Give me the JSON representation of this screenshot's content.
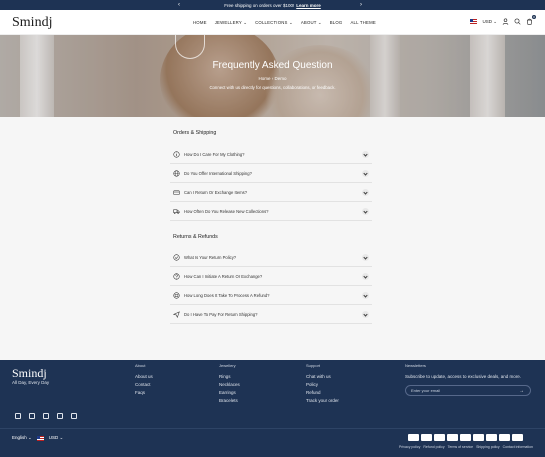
{
  "announcement": {
    "text": "Free shipping on orders over $100!",
    "link": "Learn more",
    "prev": "‹",
    "next": "›"
  },
  "header": {
    "logo": "Smindj",
    "nav": [
      "HOME",
      "JEWELLERY ⌄",
      "COLLECTIONS ⌄",
      "ABOUT ⌄",
      "BLOG",
      "ALL THEME"
    ],
    "currency": "USD ⌄",
    "cart_count": "0"
  },
  "hero": {
    "title": "Frequently Asked Question",
    "breadcrumb_home": "Home",
    "breadcrumb_sep": "›",
    "breadcrumb_current": "Demo",
    "subtitle": "Connect with us directly for questions, collaborations, or feedback."
  },
  "faq": {
    "section1": "Orders & Shipping",
    "section1_items": [
      {
        "q": "How Do I Care For My Clothing?",
        "icon": "info-icon"
      },
      {
        "q": "Do You Offer International Shipping?",
        "icon": "globe-icon"
      },
      {
        "q": "Can I Return Or Exchange Items?",
        "icon": "card-icon"
      },
      {
        "q": "How Often Do You Release New Collections?",
        "icon": "truck-icon"
      }
    ],
    "section2": "Returns & Refunds",
    "section2_items": [
      {
        "q": "What Is Your Return Policy?",
        "icon": "badge-icon"
      },
      {
        "q": "How Can I Initiate A Return Or Exchange?",
        "icon": "question-icon"
      },
      {
        "q": "How Long Does It Take To Process A Refund?",
        "icon": "box-icon"
      },
      {
        "q": "Do I Have To Pay For Return Shipping?",
        "icon": "send-icon"
      }
    ]
  },
  "footer": {
    "logo": "Smindj",
    "tagline": "All Day, Every Day",
    "about": {
      "heading": "About",
      "links": [
        "About us",
        "Contact",
        "Faqs"
      ]
    },
    "jewellery": {
      "heading": "Jewellery",
      "links": [
        "Rings",
        "Necklaces",
        "Earrings",
        "Bracelets"
      ]
    },
    "support": {
      "heading": "Support",
      "links": [
        "Chat with us",
        "Policy",
        "Refund",
        "Track your order"
      ]
    },
    "newsletter": {
      "heading": "Newsletters",
      "text": "Subscribe to update, access to exclusive deals, and more.",
      "placeholder": "Enter your email",
      "submit": "→"
    },
    "language": "English ⌄",
    "currency": "USD ⌄",
    "legal": [
      "Privacy policy",
      "Refund policy",
      "Terms of service",
      "Shipping policy",
      "Contact information"
    ]
  }
}
